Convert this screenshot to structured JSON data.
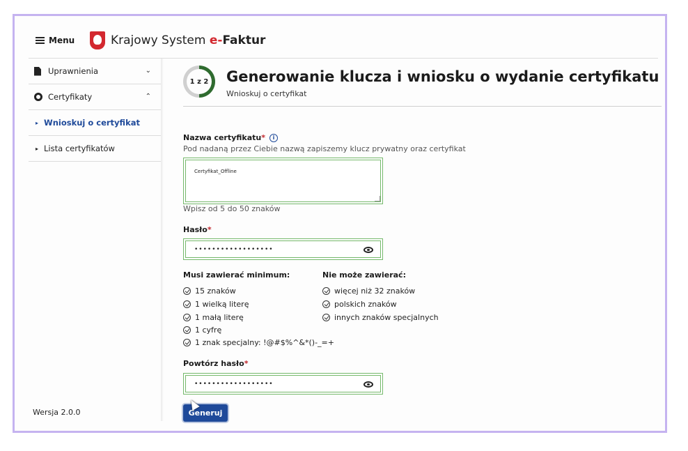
{
  "header": {
    "menu_label": "Menu",
    "app_title_prefix": "Krajowy System ",
    "app_title_accent": "e-",
    "app_title_suffix": "Faktur"
  },
  "sidebar": {
    "items": [
      {
        "label": "Uprawnienia",
        "icon": "document-icon",
        "chevron": "chevron-down"
      },
      {
        "label": "Certyfikaty",
        "icon": "ring-icon",
        "chevron": "chevron-up"
      },
      {
        "label": "Wnioskuj o certyfikat",
        "active": true
      },
      {
        "label": "Lista certyfikatów"
      }
    ],
    "version": "Wersja 2.0.0"
  },
  "stepper": {
    "label": "1 z 2",
    "progress": 0.5
  },
  "page": {
    "title": "Generowanie klucza i wniosku o wydanie certyfikatu",
    "subtitle": "Wnioskuj o certyfikat"
  },
  "form": {
    "cert_name": {
      "label": "Nazwa certyfikatu",
      "required_mark": "*",
      "info_icon": "i",
      "description": "Pod nadaną przez Ciebie nazwą zapiszemy klucz prywatny oraz certyfikat",
      "value": "Certyfikat_Offline",
      "hint": "Wpisz od 5 do 50 znaków"
    },
    "password": {
      "label": "Hasło",
      "required_mark": "*",
      "value": "••••••••••••••••••"
    },
    "rules": {
      "must_head": "Musi zawierać minimum:",
      "must": [
        "15 znaków",
        "1 wielką literę",
        "1 małą literę",
        "1 cyfrę",
        "1 znak specjalny: !@#$%^&*()-_=+"
      ],
      "cannot_head": "Nie może zawierać:",
      "cannot": [
        "więcej niż 32 znaków",
        "polskich znaków",
        "innych znaków specjalnych"
      ]
    },
    "repeat_password": {
      "label": "Powtórz hasło",
      "required_mark": "*",
      "value": "••••••••••••••••••"
    },
    "submit_label": "Generuj"
  },
  "colors": {
    "accent": "#1f4a9a",
    "required": "#c0272d",
    "valid_border": "#74b86a",
    "stepper_progress": "#2f6b2f",
    "frame": "#c5b3f0"
  }
}
